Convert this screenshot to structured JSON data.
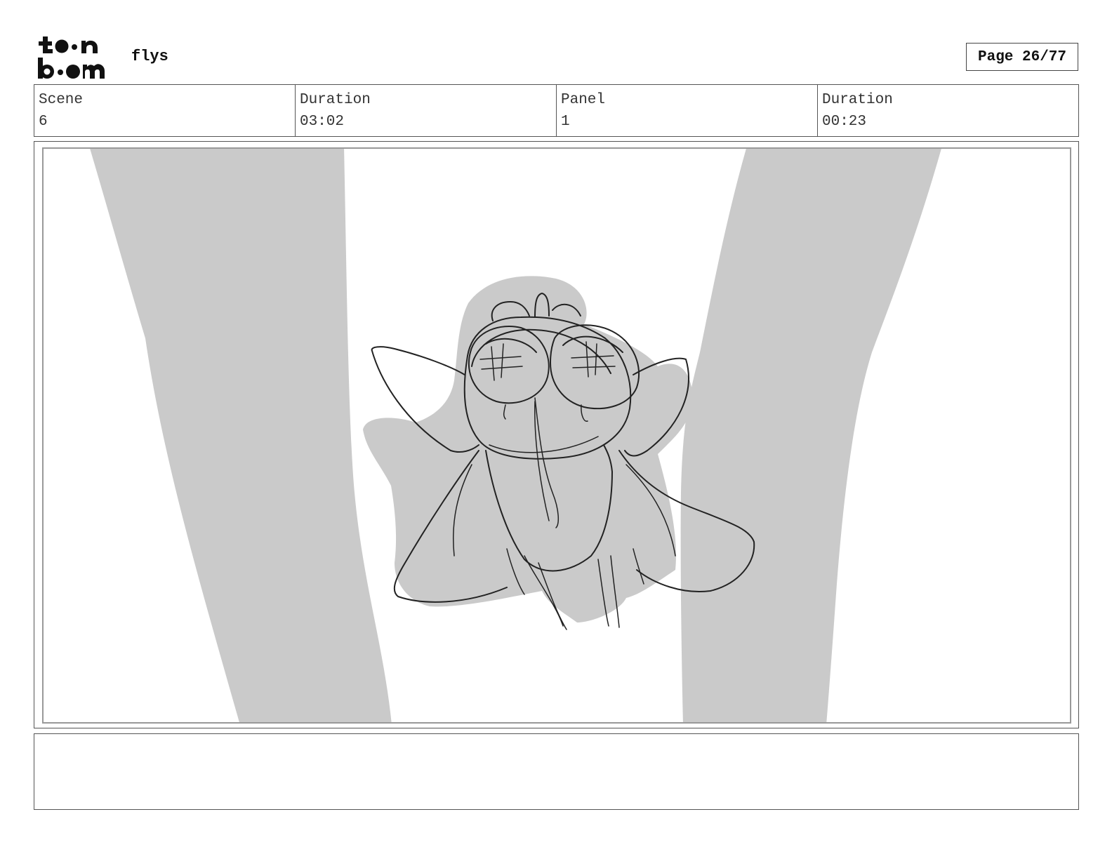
{
  "header": {
    "logo": {
      "text_line1": "toon",
      "text_line2": "boom"
    },
    "project_title": "flys",
    "page_label": "Page 26/77"
  },
  "info": {
    "scene_label": "Scene",
    "scene_value": "6",
    "scene_duration_label": "Duration",
    "scene_duration_value": "03:02",
    "panel_label": "Panel",
    "panel_value": "1",
    "panel_duration_label": "Duration",
    "panel_duration_value": "00:23"
  },
  "panel": {
    "sketch_subject": "fly-character-sketch",
    "fill_color": "#cacaca",
    "line_color": "#222222"
  },
  "notes": {
    "text": ""
  }
}
